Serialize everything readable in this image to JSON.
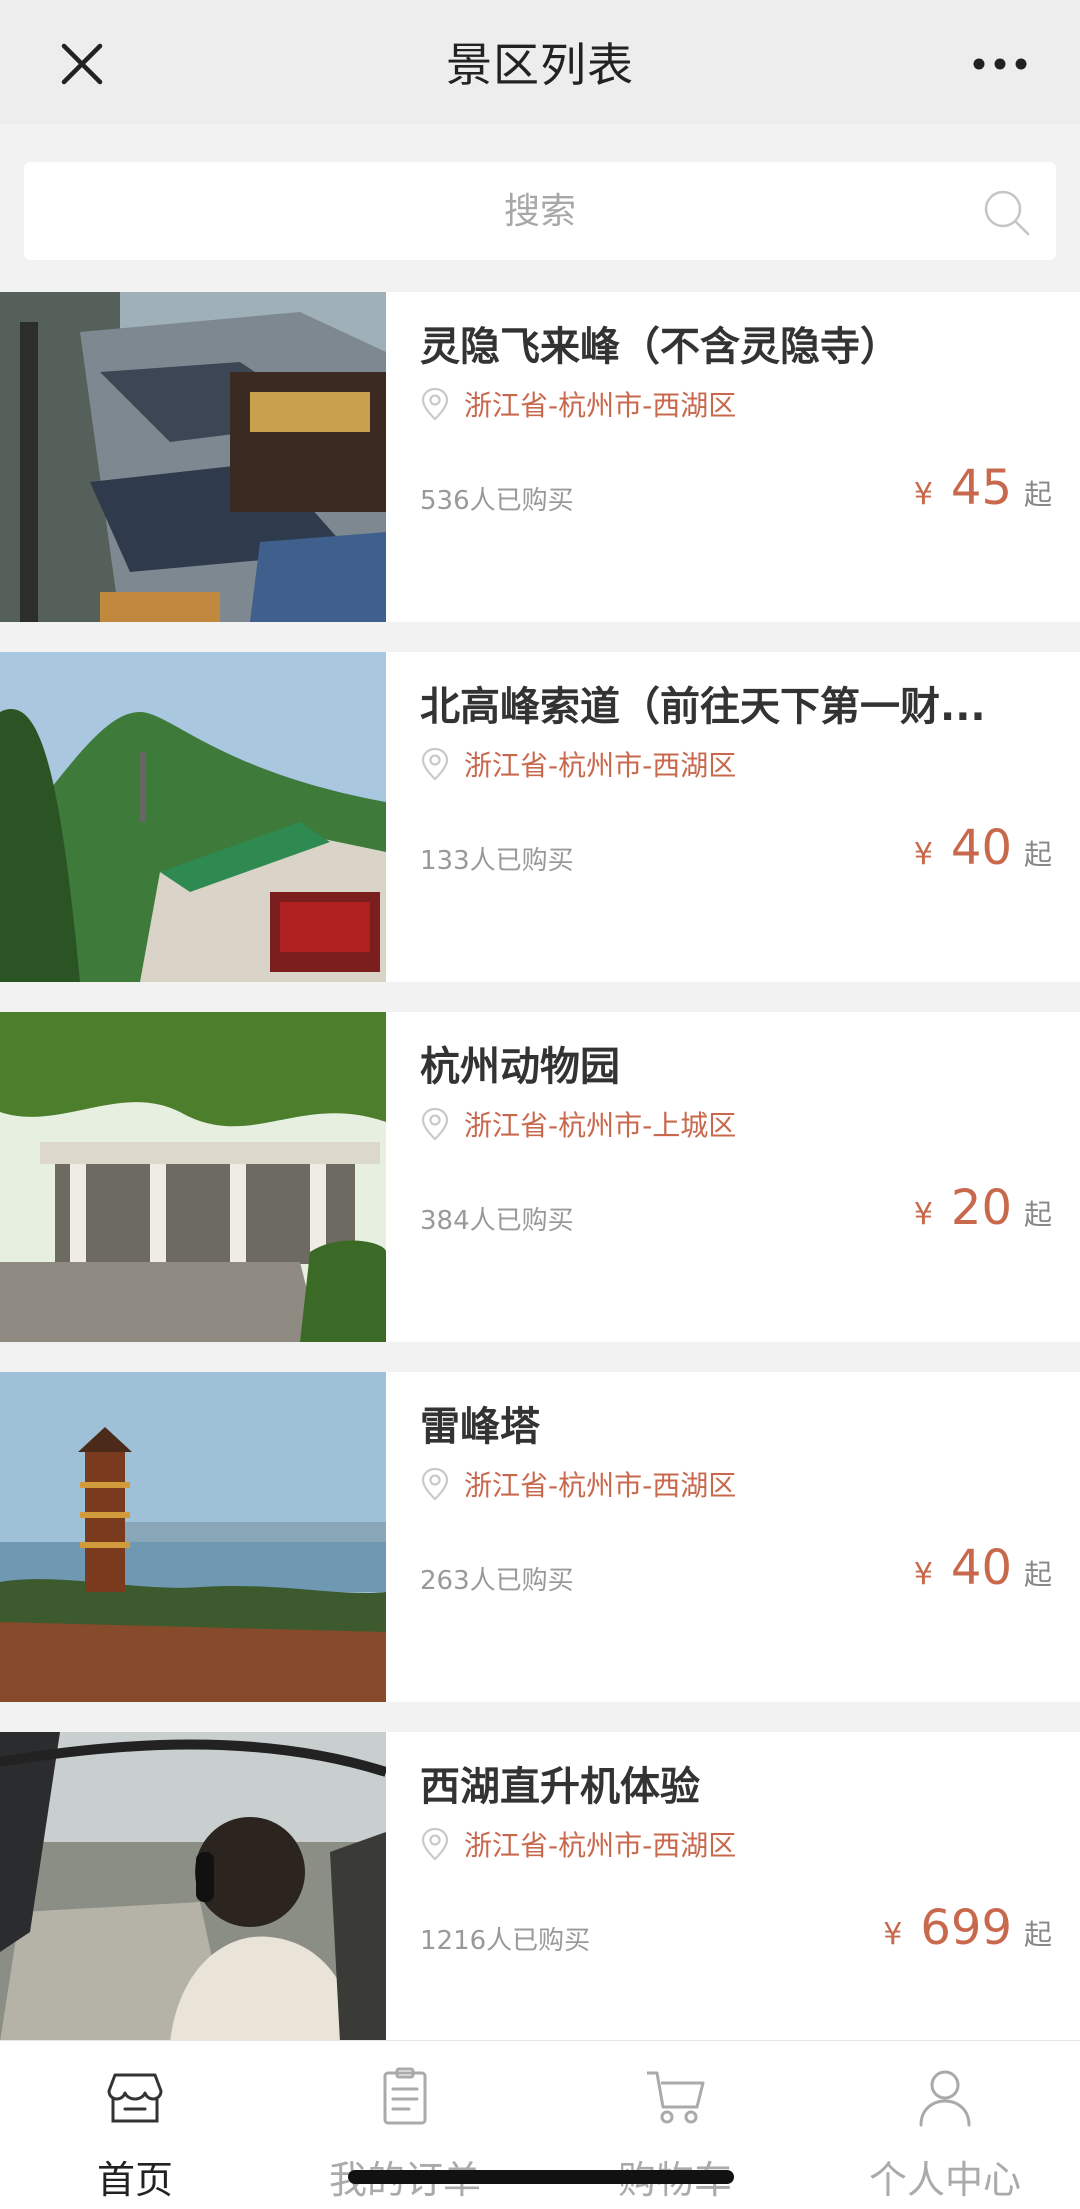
{
  "header": {
    "title": "景区列表"
  },
  "search": {
    "placeholder": "搜索"
  },
  "spots": [
    {
      "name": "灵隐飞来峰（不含灵隐寺）",
      "location": "浙江省-杭州市-西湖区",
      "sold": "536人已购买",
      "currency": "¥",
      "price": "45",
      "suffix": "起"
    },
    {
      "name": "北高峰索道（前往天下第一财...",
      "location": "浙江省-杭州市-西湖区",
      "sold": "133人已购买",
      "currency": "¥",
      "price": "40",
      "suffix": "起"
    },
    {
      "name": "杭州动物园",
      "location": "浙江省-杭州市-上城区",
      "sold": "384人已购买",
      "currency": "¥",
      "price": "20",
      "suffix": "起"
    },
    {
      "name": "雷峰塔",
      "location": "浙江省-杭州市-西湖区",
      "sold": "263人已购买",
      "currency": "¥",
      "price": "40",
      "suffix": "起"
    },
    {
      "name": "西湖直升机体验",
      "location": "浙江省-杭州市-西湖区",
      "sold": "1216人已购买",
      "currency": "¥",
      "price": "699",
      "suffix": "起"
    }
  ],
  "tabbar": {
    "items": [
      {
        "label": "首页",
        "icon": "store-icon",
        "active": true
      },
      {
        "label": "我的订单",
        "icon": "order-list-icon",
        "active": false
      },
      {
        "label": "购物车",
        "icon": "cart-icon",
        "active": false
      },
      {
        "label": "个人中心",
        "icon": "person-icon",
        "active": false
      }
    ]
  },
  "colors": {
    "accent": "#c8694e",
    "header_bg": "#ededed",
    "page_bg": "#f2f2f2"
  }
}
